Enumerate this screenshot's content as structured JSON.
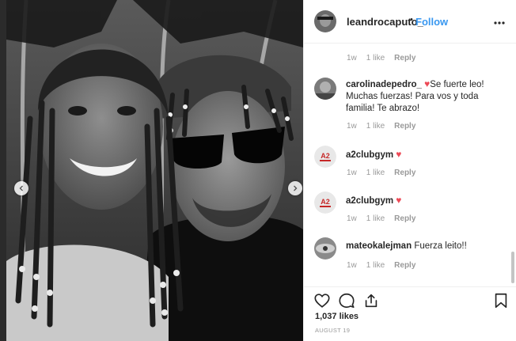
{
  "post": {
    "username": "leandrocaputo_",
    "separator": "•",
    "follow_label": "Follow",
    "likes_text": "1,037 likes",
    "date": "AUGUST 19"
  },
  "comments": [
    {
      "user": "",
      "text": "",
      "time": "1w",
      "likes": "1 like",
      "reply": "Reply"
    },
    {
      "user": "carolinadepedro_",
      "text": "Se fuerte leo! Muchas fuerzas! Para vos y toda familia! Te abrazo!",
      "time": "1w",
      "likes": "1 like",
      "reply": "Reply"
    },
    {
      "user": "a2clubgym",
      "text": "",
      "time": "1w",
      "likes": "1 like",
      "reply": "Reply"
    },
    {
      "user": "a2clubgym",
      "text": "",
      "time": "1w",
      "likes": "1 like",
      "reply": "Reply"
    },
    {
      "user": "mateokalejman",
      "text": "Fuerza leito!!",
      "time": "1w",
      "likes": "1 like",
      "reply": "Reply"
    }
  ],
  "icons": {
    "more": "more-options-icon",
    "like": "heart-icon",
    "comment": "comment-icon",
    "share": "share-icon",
    "save": "bookmark-icon",
    "prev": "chevron-left-icon",
    "next": "chevron-right-icon"
  },
  "colors": {
    "follow": "#3897f0",
    "heart": "#ed4956",
    "meta": "#999999"
  }
}
